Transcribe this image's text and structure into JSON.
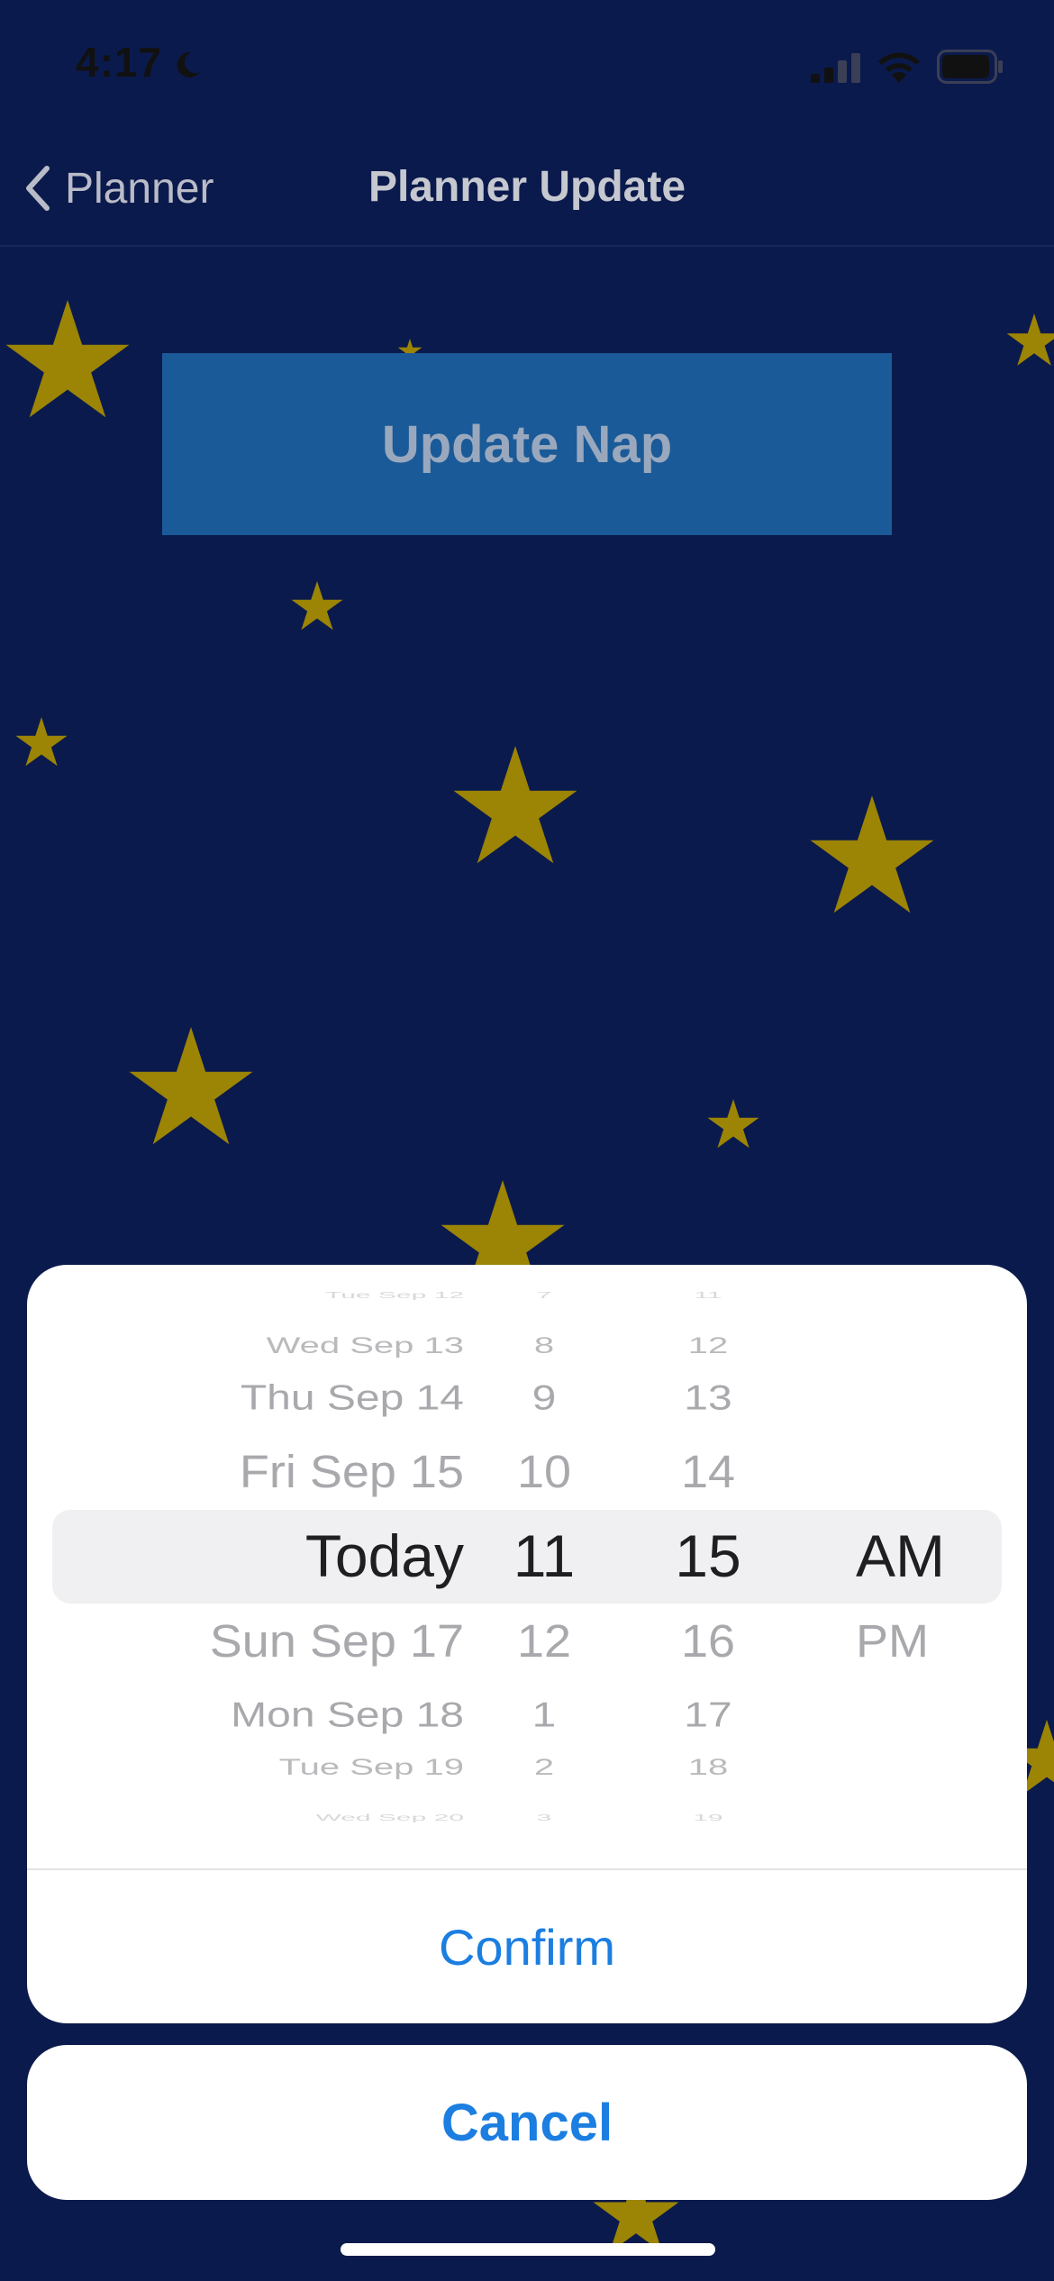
{
  "status_bar": {
    "time": "4:17",
    "moon_icon": "moon-icon",
    "signal_icon": "cellular-signal-icon",
    "wifi_icon": "wifi-icon",
    "battery_icon": "battery-icon"
  },
  "nav": {
    "back_label": "Planner",
    "title": "Planner Update"
  },
  "main": {
    "update_button_label": "Update Nap"
  },
  "picker": {
    "date_column": [
      "Tue Sep 12",
      "Wed Sep 13",
      "Thu Sep 14",
      "Fri Sep 15",
      "Today",
      "Sun Sep 17",
      "Mon Sep 18",
      "Tue Sep 19",
      "Wed Sep 20"
    ],
    "hour_column": [
      "7",
      "8",
      "9",
      "10",
      "11",
      "12",
      "1",
      "2",
      "3"
    ],
    "minute_column": [
      "11",
      "12",
      "13",
      "14",
      "15",
      "16",
      "17",
      "18",
      "19"
    ],
    "ampm_column": [
      "AM",
      "PM"
    ],
    "selected": {
      "date": "Today",
      "hour": "11",
      "minute": "15",
      "ampm": "AM"
    }
  },
  "actions": {
    "confirm_label": "Confirm",
    "cancel_label": "Cancel"
  },
  "colors": {
    "background": "#0b1a4c",
    "star": "#9c8405",
    "button": "#1a5a98",
    "accent": "#1b7ee0"
  }
}
